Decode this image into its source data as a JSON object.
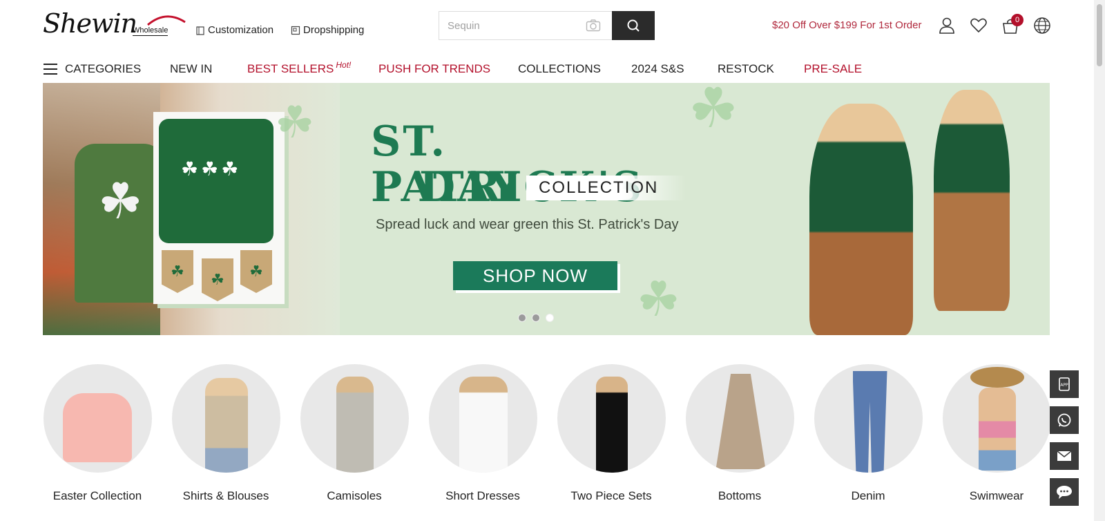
{
  "brand": {
    "name": "Shewin",
    "sub": "Wholesale"
  },
  "toplinks": [
    {
      "label": "Customization",
      "icon": "customization-icon"
    },
    {
      "label": "Dropshipping",
      "icon": "dropshipping-icon"
    }
  ],
  "search": {
    "placeholder": "Sequin",
    "value": ""
  },
  "promo": "$20 Off Over $199 For 1st Order",
  "header_icons": {
    "account": "user-icon",
    "wishlist": "heart-icon",
    "cart": "cart-icon",
    "cart_count": "0",
    "language": "globe-icon"
  },
  "nav": {
    "categories": "CATEGORIES",
    "items": [
      {
        "label": "NEW IN",
        "highlight": false
      },
      {
        "label": "BEST SELLERS",
        "highlight": true,
        "tag": "Hot!"
      },
      {
        "label": "PUSH FOR TRENDS",
        "highlight": true
      },
      {
        "label": "COLLECTIONS",
        "highlight": false
      },
      {
        "label": "2024 S&S",
        "highlight": false
      },
      {
        "label": "RESTOCK",
        "highlight": false
      },
      {
        "label": "PRE-SALE",
        "highlight": true
      }
    ]
  },
  "banner": {
    "title_line1": "ST. PATRICK'S",
    "title_line2": "DAY",
    "collection": "COLLECTION",
    "subtitle": "Spread luck and wear green this St. Patrick's Day",
    "cta": "SHOP NOW",
    "slides": 3,
    "active_slide": 3
  },
  "categories": [
    {
      "label": "Easter Collection"
    },
    {
      "label": "Shirts & Blouses"
    },
    {
      "label": "Camisoles"
    },
    {
      "label": "Short Dresses"
    },
    {
      "label": "Two Piece Sets"
    },
    {
      "label": "Bottoms"
    },
    {
      "label": "Denim"
    },
    {
      "label": "Swimwear"
    }
  ],
  "side_widgets": [
    "app-icon",
    "whatsapp-icon",
    "email-icon",
    "chat-icon"
  ],
  "colors": {
    "accent_red": "#b3102b",
    "promo_red": "#b0283c",
    "banner_green": "#1e7a52",
    "dark": "#2b2b2b"
  }
}
